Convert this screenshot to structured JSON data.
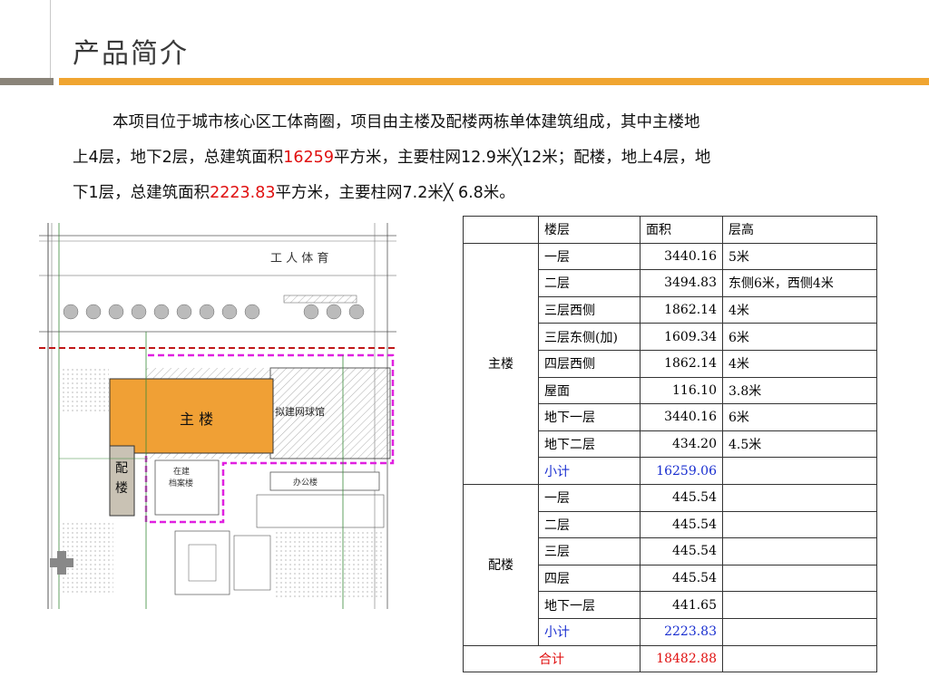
{
  "title": "产品简介",
  "intro": {
    "line1": "本项目位于城市核心区工体商圈，项目由主楼及配楼两栋单体建筑组成，其中主楼地",
    "line2_a": "上4层，地下2层，总建筑面积",
    "line2_b": "16259",
    "line2_c": "平方米，主要柱网12.9米╳12米；配楼，地上4层，地",
    "line3_a": "下1层，总建筑面积",
    "line3_b": "2223.83",
    "line3_c": "平方米，主要柱网7.2米╳ 6.8米。"
  },
  "plan": {
    "top_label": "工  人  体  育",
    "main_label": "主 楼",
    "annex_label": "配楼",
    "right_label": "拟建网球馆",
    "office_label": "办公楼",
    "small_label_1": "在建",
    "small_label_2": "档案楼"
  },
  "table": {
    "headers": [
      "",
      "楼层",
      "面积",
      "层高"
    ],
    "main_group": "主楼",
    "main_rows": [
      {
        "floor": "一层",
        "area": "3440.16",
        "height": "5米"
      },
      {
        "floor": "二层",
        "area": "3494.83",
        "height": "东侧6米，西侧4米"
      },
      {
        "floor": "三层西侧",
        "area": "1862.14",
        "height": "4米"
      },
      {
        "floor": "三层东侧(加)",
        "area": "1609.34",
        "height": "6米"
      },
      {
        "floor": "四层西侧",
        "area": "1862.14",
        "height": "4米"
      },
      {
        "floor": "屋面",
        "area": "116.10",
        "height": "3.8米"
      },
      {
        "floor": "地下一层",
        "area": "3440.16",
        "height": "6米"
      },
      {
        "floor": "地下二层",
        "area": "434.20",
        "height": "4.5米"
      }
    ],
    "main_subtotal": {
      "label": "小计",
      "area": "16259.06"
    },
    "annex_group": "配楼",
    "annex_rows": [
      {
        "floor": "一层",
        "area": "445.54",
        "height": ""
      },
      {
        "floor": "二层",
        "area": "445.54",
        "height": ""
      },
      {
        "floor": "三层",
        "area": "445.54",
        "height": ""
      },
      {
        "floor": "四层",
        "area": "445.54",
        "height": ""
      },
      {
        "floor": "地下一层",
        "area": "441.65",
        "height": ""
      }
    ],
    "annex_subtotal": {
      "label": "小计",
      "area": "2223.83"
    },
    "total": {
      "label": "合计",
      "area": "18482.88"
    }
  }
}
